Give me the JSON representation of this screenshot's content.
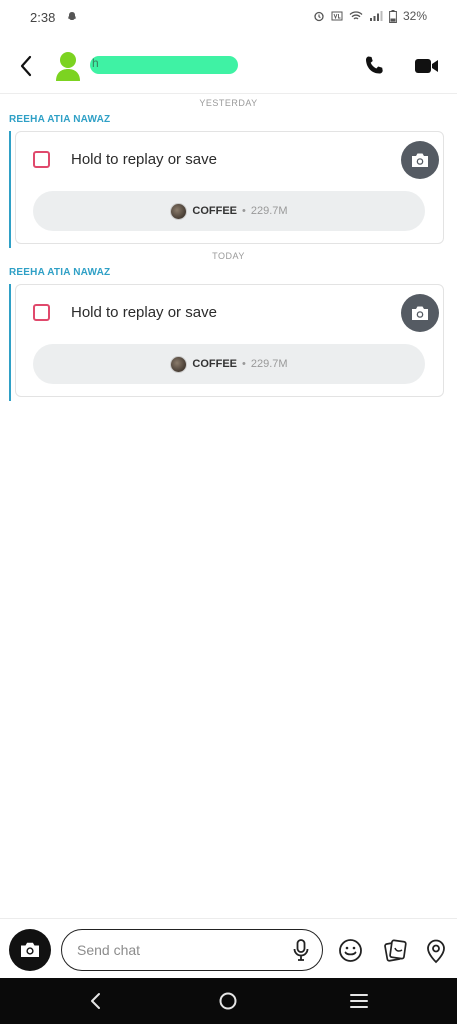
{
  "status_bar": {
    "time": "2:38",
    "battery": "32%",
    "icons": [
      "snapchat-ghost-icon",
      "alarm-icon",
      "volte-icon",
      "wifi-icon",
      "signal-icon",
      "battery-icon"
    ]
  },
  "header": {
    "contact_name": "h",
    "icons": [
      "back-arrow-icon",
      "bitmoji-avatar-icon",
      "phone-icon",
      "video-icon"
    ]
  },
  "messages": [
    {
      "date_label": "YESTERDAY",
      "sender": "REEHA ATIA NAWAZ",
      "snap_text": "Hold to replay or save",
      "pill_title": "COFFEE",
      "pill_separator": "•",
      "pill_count": "229.7M"
    },
    {
      "date_label": "TODAY",
      "sender": "REEHA ATIA NAWAZ",
      "snap_text": "Hold to replay or save",
      "pill_title": "COFFEE",
      "pill_separator": "•",
      "pill_count": "229.7M"
    }
  ],
  "composer": {
    "placeholder": "Send chat",
    "value": "",
    "icons": [
      "camera-icon",
      "microphone-icon",
      "emoji-icon",
      "sticker-icon",
      "map-pin-icon"
    ]
  },
  "colors": {
    "accent_blue": "#2fa0c6",
    "snap_red": "#e0496c",
    "avatar_green": "#7cd321",
    "name_highlight": "#3ff2a4"
  }
}
